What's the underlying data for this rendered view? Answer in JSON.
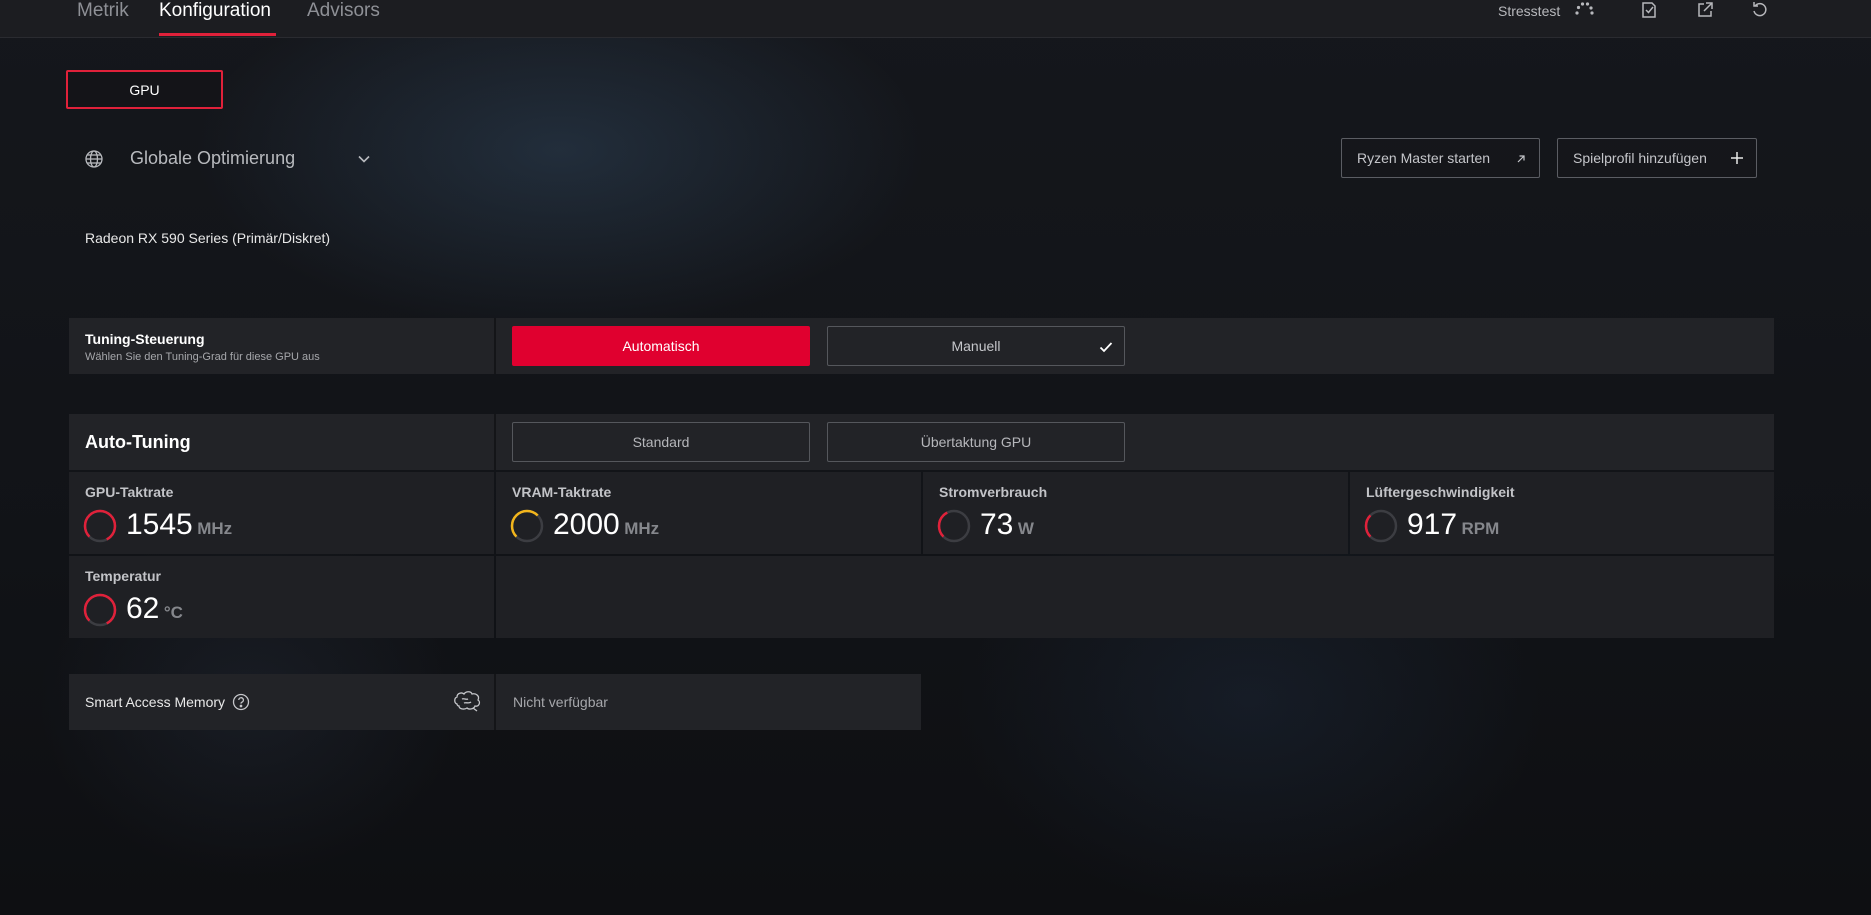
{
  "nav": {
    "tabs": [
      {
        "label": "Metrik",
        "active": false
      },
      {
        "label": "Konfiguration",
        "active": true
      },
      {
        "label": "Advisors",
        "active": false
      }
    ],
    "stresstest_label": "Stresstest",
    "accent_color": "#e0213a"
  },
  "device_tab": {
    "label": "GPU"
  },
  "profile": {
    "label": "Globale Optimierung",
    "ryzen_master_label": "Ryzen Master starten",
    "add_game_profile_label": "Spielprofil hinzufügen"
  },
  "device_name": "Radeon RX 590 Series (Primär/Diskret)",
  "tuning_control": {
    "title": "Tuning-Steuerung",
    "subtitle": "Wählen Sie den Tuning-Grad für diese GPU aus",
    "automatic_label": "Automatisch",
    "manual_label": "Manuell"
  },
  "auto_tuning": {
    "title": "Auto-Tuning",
    "standard_label": "Standard",
    "overclock_label": "Übertaktung GPU"
  },
  "metrics": [
    {
      "label": "GPU-Taktrate",
      "value": "1545",
      "unit": "MHz",
      "gauge_color": "#e0213a",
      "gauge_level": 0.8
    },
    {
      "label": "VRAM-Taktrate",
      "value": "2000",
      "unit": "MHz",
      "gauge_color": "#f2b51c",
      "gauge_level": 0.5
    },
    {
      "label": "Stromverbrauch",
      "value": "73",
      "unit": "W",
      "gauge_color": "#e0213a",
      "gauge_level": 0.3
    },
    {
      "label": "Lüftergeschwindigkeit",
      "value": "917",
      "unit": "RPM",
      "gauge_color": "#e0213a",
      "gauge_level": 0.25
    },
    {
      "label": "Temperatur",
      "value": "62",
      "unit": "°C",
      "gauge_color": "#e0213a",
      "gauge_level": 0.8
    }
  ],
  "smart_access_memory": {
    "label": "Smart Access Memory",
    "status": "Nicht verfügbar"
  }
}
